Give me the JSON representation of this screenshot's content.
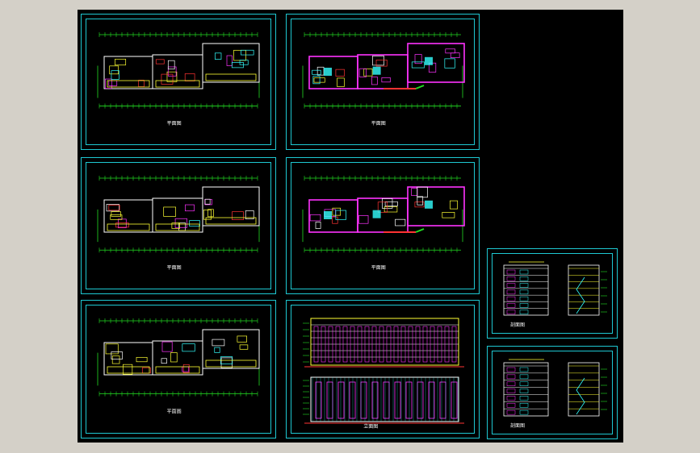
{
  "colors": {
    "background": "#000000",
    "frame": "#1ec8d2",
    "dimension": "#22dd22",
    "wall": "#ffffff",
    "accent_yellow": "#ffff33",
    "accent_magenta": "#ff33ff",
    "accent_cyan": "#33ffff",
    "accent_red": "#ff3333",
    "window_chrome": "#d4d0c8"
  },
  "sheets": [
    {
      "id": "plan-1",
      "type": "floor-plan",
      "label": "平面图"
    },
    {
      "id": "plan-2",
      "type": "floor-plan-magenta",
      "label": "平面图"
    },
    {
      "id": "plan-3",
      "type": "floor-plan",
      "label": "平面图"
    },
    {
      "id": "plan-4",
      "type": "floor-plan-magenta",
      "label": "平面图"
    },
    {
      "id": "plan-5",
      "type": "floor-plan",
      "label": "平面图"
    },
    {
      "id": "elevations",
      "type": "elevation",
      "label": "立面图"
    },
    {
      "id": "section-1",
      "type": "section",
      "label": "剖面图"
    },
    {
      "id": "section-2",
      "type": "section",
      "label": "剖面图"
    }
  ]
}
